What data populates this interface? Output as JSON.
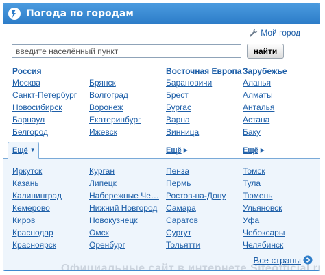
{
  "header": {
    "title": "Погода по городам"
  },
  "my_city": {
    "label": "Мой город"
  },
  "search": {
    "placeholder": "введите населённый пункт",
    "button_label": "найти"
  },
  "columns": [
    {
      "heading": "Россия",
      "cities": [
        "Москва",
        "Санкт-Петербург",
        "Новосибирск",
        "Барнаул",
        "Белгород"
      ]
    },
    {
      "heading": "",
      "cities": [
        "Брянск",
        "Волгоград",
        "Воронеж",
        "Екатеринбург",
        "Ижевск"
      ]
    },
    {
      "heading": "Восточная Европа",
      "cities": [
        "Барановичи",
        "Брест",
        "Бургас",
        "Варна",
        "Винница"
      ]
    },
    {
      "heading": "Зарубежье",
      "cities": [
        "Аланья",
        "Алматы",
        "Анталья",
        "Астана",
        "Баку"
      ]
    }
  ],
  "more_links": {
    "russia": "Ещё",
    "eastern_europe": "Ещё",
    "abroad": "Ещё"
  },
  "expanded_columns": [
    [
      "Иркутск",
      "Казань",
      "Калининград",
      "Кемерово",
      "Киров",
      "Краснодар",
      "Красноярск"
    ],
    [
      "Курган",
      "Липецк",
      "Набережные Че…",
      "Нижний Новгород",
      "Новокузнецк",
      "Омск",
      "Оренбург"
    ],
    [
      "Пенза",
      "Пермь",
      "Ростов-на-Дону",
      "Самара",
      "Саратов",
      "Сургут",
      "Тольятти"
    ],
    [
      "Томск",
      "Тула",
      "Тюмень",
      "Ульяновск",
      "Уфа",
      "Чебоксары",
      "Челябинск"
    ]
  ],
  "all_countries": {
    "label": "Все страны"
  },
  "watermark": {
    "text": "Официальные сайт в интернете Siteofficial.ru"
  },
  "colors": {
    "header": "#2d7cc8",
    "link": "#1e5fa8",
    "panel": "#eef5fc",
    "border": "#3f89cf"
  }
}
